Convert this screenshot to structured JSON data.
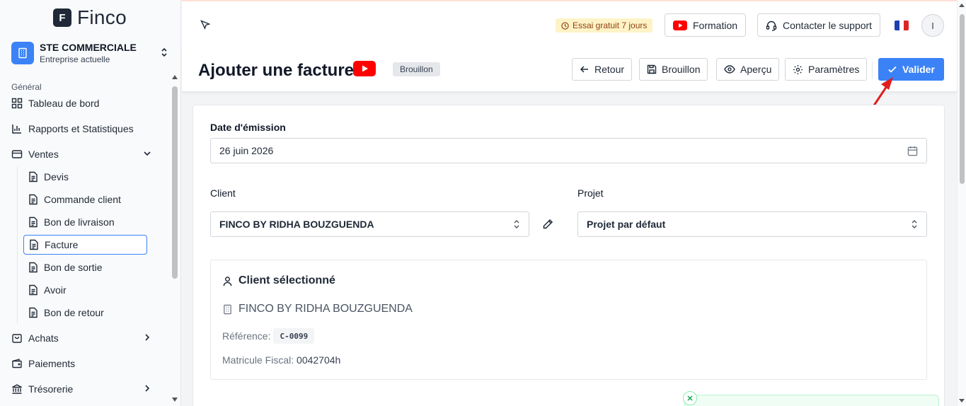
{
  "brand": {
    "name": "Finco",
    "logo_letter": "F"
  },
  "company": {
    "name": "STE COMMERCIALE",
    "subtitle": "Entreprise actuelle"
  },
  "sidebar": {
    "section_general": "Général",
    "items": {
      "dashboard": "Tableau de bord",
      "reports": "Rapports et Statistiques",
      "sales": "Ventes",
      "purchases": "Achats",
      "payments": "Paiements",
      "treasury": "Trésorerie"
    },
    "sales_sub": [
      "Devis",
      "Commande client",
      "Bon de livraison",
      "Facture",
      "Bon de sortie",
      "Avoir",
      "Bon de retour"
    ],
    "active_sub": "Facture"
  },
  "topbar": {
    "trial": "Essai gratuit 7 jours",
    "training": "Formation",
    "support": "Contacter le support",
    "language": "FR",
    "avatar_initial": "I"
  },
  "header": {
    "title": "Ajouter une facture",
    "status": "Brouillon",
    "buttons": {
      "back": "Retour",
      "draft": "Brouillon",
      "preview": "Aperçu",
      "settings": "Paramètres",
      "validate": "Valider"
    }
  },
  "form": {
    "issue_date_label": "Date d'émission",
    "issue_date_value": "26 juin 2026",
    "client_label": "Client",
    "client_value": "FINCO BY RIDHA BOUZGUENDA",
    "project_label": "Projet",
    "project_value": "Projet par défaut"
  },
  "selected_client": {
    "title": "Client sélectionné",
    "name": "FINCO BY RIDHA BOUZGUENDA",
    "reference_label": "Référence:",
    "reference_value": "C-0099",
    "tax_id_label": "Matricule Fiscal:",
    "tax_id_value": "0042704h"
  },
  "colors": {
    "primary": "#3b82f6",
    "youtube": "#ff0000",
    "annotation_arrow": "#e11d1d"
  }
}
